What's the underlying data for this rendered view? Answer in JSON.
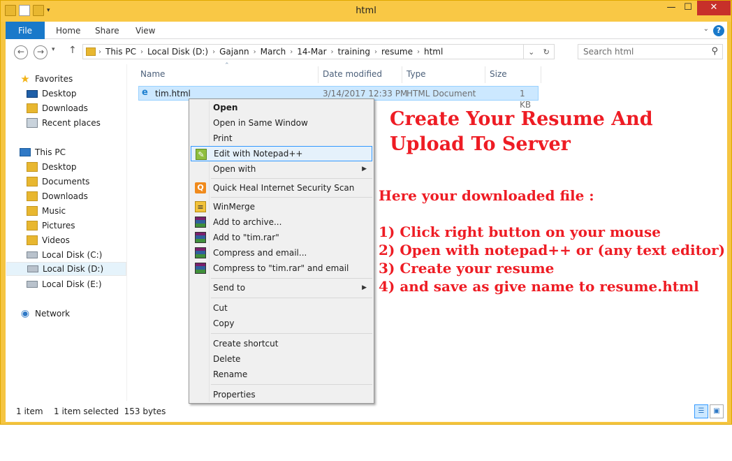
{
  "window": {
    "title": "html",
    "controls": {
      "minimize": "—",
      "maximize": "☐",
      "close": "✕"
    }
  },
  "ribbon": {
    "tabs": [
      "File",
      "Home",
      "Share",
      "View"
    ],
    "help": "?"
  },
  "address": {
    "crumbs": [
      "This PC",
      "Local Disk (D:)",
      "Gajann",
      "March",
      "14-Mar",
      "training",
      "resume",
      "html"
    ],
    "search_placeholder": "Search html"
  },
  "nav": {
    "favorites": {
      "label": "Favorites",
      "items": [
        "Desktop",
        "Downloads",
        "Recent places"
      ]
    },
    "this_pc": {
      "label": "This PC",
      "items": [
        "Desktop",
        "Documents",
        "Downloads",
        "Music",
        "Pictures",
        "Videos",
        "Local Disk (C:)",
        "Local Disk (D:)",
        "Local Disk (E:)"
      ]
    },
    "network": "Network"
  },
  "columns": [
    "Name",
    "Date modified",
    "Type",
    "Size"
  ],
  "files": [
    {
      "name": "tim.html",
      "modified": "3/14/2017 12:33 PM",
      "type": "HTML Document",
      "size": "1 KB"
    }
  ],
  "status": {
    "count": "1 item",
    "selection": "1 item selected  153 bytes"
  },
  "context_menu": {
    "items": [
      "Open",
      "Open in Same Window",
      "Print",
      "Edit with Notepad++",
      "Open with",
      "Quick Heal Internet Security Scan",
      "WinMerge",
      "Add to archive...",
      "Add to \"tim.rar\"",
      "Compress and email...",
      "Compress to \"tim.rar\" and email",
      "Send to",
      "Cut",
      "Copy",
      "Create shortcut",
      "Delete",
      "Rename",
      "Properties"
    ]
  },
  "annotation": {
    "title_line1": "Create Your Resume And",
    "title_line2": "Upload To Server",
    "intro": "Here your downloaded file :",
    "steps": [
      "1) Click right button on your mouse",
      "2) Open with notepad++ or (any text editor)",
      "3) Create your resume",
      "4) and save as give name to resume.html"
    ]
  }
}
